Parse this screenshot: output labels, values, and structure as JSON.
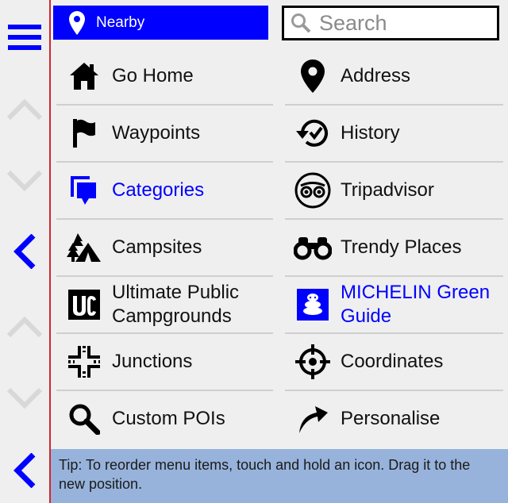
{
  "header": {
    "nearby_label": "Nearby",
    "search_placeholder": "Search"
  },
  "menu": {
    "left": [
      {
        "label": "Go Home",
        "icon": "home-icon"
      },
      {
        "label": "Waypoints",
        "icon": "flag-icon"
      },
      {
        "label": "Categories",
        "icon": "categories-icon"
      },
      {
        "label": "Campsites",
        "icon": "campsite-icon"
      },
      {
        "label": "Ultimate Public Campgrounds",
        "icon": "uc-logo-icon"
      },
      {
        "label": "Junctions",
        "icon": "junction-icon"
      },
      {
        "label": "Custom POIs",
        "icon": "magnifier-icon"
      }
    ],
    "right": [
      {
        "label": "Address",
        "icon": "location-pin-icon"
      },
      {
        "label": "History",
        "icon": "history-icon"
      },
      {
        "label": "Tripadvisor",
        "icon": "tripadvisor-icon"
      },
      {
        "label": "Trendy Places",
        "icon": "binoculars-icon"
      },
      {
        "label": "MICHELIN Green Guide",
        "icon": "michelin-icon"
      },
      {
        "label": "Coordinates",
        "icon": "crosshair-icon"
      },
      {
        "label": "Personalise",
        "icon": "arrow-icon"
      }
    ]
  },
  "tip": "Tip: To reorder menu items, touch and hold an icon. Drag it to the new position.",
  "colors": {
    "accent": "#0000ff",
    "tip_bg": "#97b3db",
    "divider": "#d0262e",
    "disabled": "#d8d8d8"
  }
}
